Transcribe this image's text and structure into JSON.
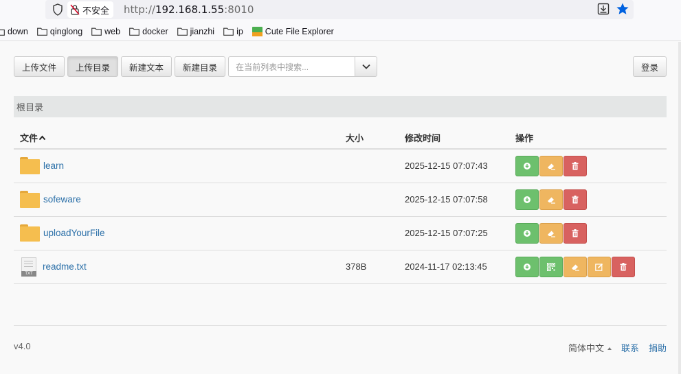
{
  "browser": {
    "insecure_label": "不安全",
    "url_prefix": "http://",
    "url_host": "192.168.1.55",
    "url_port": ":8010"
  },
  "bookmarks": [
    {
      "label": "down",
      "icon": "folder-icon"
    },
    {
      "label": "qinglong",
      "icon": "folder-icon"
    },
    {
      "label": "web",
      "icon": "folder-icon"
    },
    {
      "label": "docker",
      "icon": "folder-icon"
    },
    {
      "label": "jianzhi",
      "icon": "folder-icon"
    },
    {
      "label": "ip",
      "icon": "folder-icon"
    },
    {
      "label": "Cute File Explorer",
      "icon": "cute-logo-icon"
    }
  ],
  "toolbar": {
    "upload_file": "上传文件",
    "upload_dir": "上传目录",
    "new_text": "新建文本",
    "new_dir": "新建目录",
    "search_placeholder": "在当前列表中搜索...",
    "login": "登录"
  },
  "breadcrumb": "根目录",
  "table": {
    "headers": {
      "name": "文件",
      "size": "大小",
      "time": "修改时间",
      "ops": "操作"
    },
    "rows": [
      {
        "name": "learn",
        "type": "folder",
        "size": "",
        "time": "2025-12-15 07:07:43",
        "actions": [
          "download",
          "rename",
          "delete"
        ]
      },
      {
        "name": "sofeware",
        "type": "folder",
        "size": "",
        "time": "2025-12-15 07:07:58",
        "actions": [
          "download",
          "rename",
          "delete"
        ]
      },
      {
        "name": "uploadYourFile",
        "type": "folder",
        "size": "",
        "time": "2025-12-15 07:07:25",
        "actions": [
          "download",
          "rename",
          "delete"
        ]
      },
      {
        "name": "readme.txt",
        "type": "txt",
        "size": "378B",
        "time": "2024-11-17 02:13:45",
        "actions": [
          "download",
          "qrcode",
          "rename",
          "edit",
          "delete"
        ]
      }
    ],
    "txt_label": "TXT"
  },
  "footer": {
    "version": "v4.0",
    "language": "简体中文",
    "contact": "联系",
    "donate": "捐助"
  },
  "colors": {
    "green": "#6dc06d",
    "orange": "#efb660",
    "red": "#d86260",
    "link": "#2a6fa8",
    "folder": "#f5be4f"
  }
}
